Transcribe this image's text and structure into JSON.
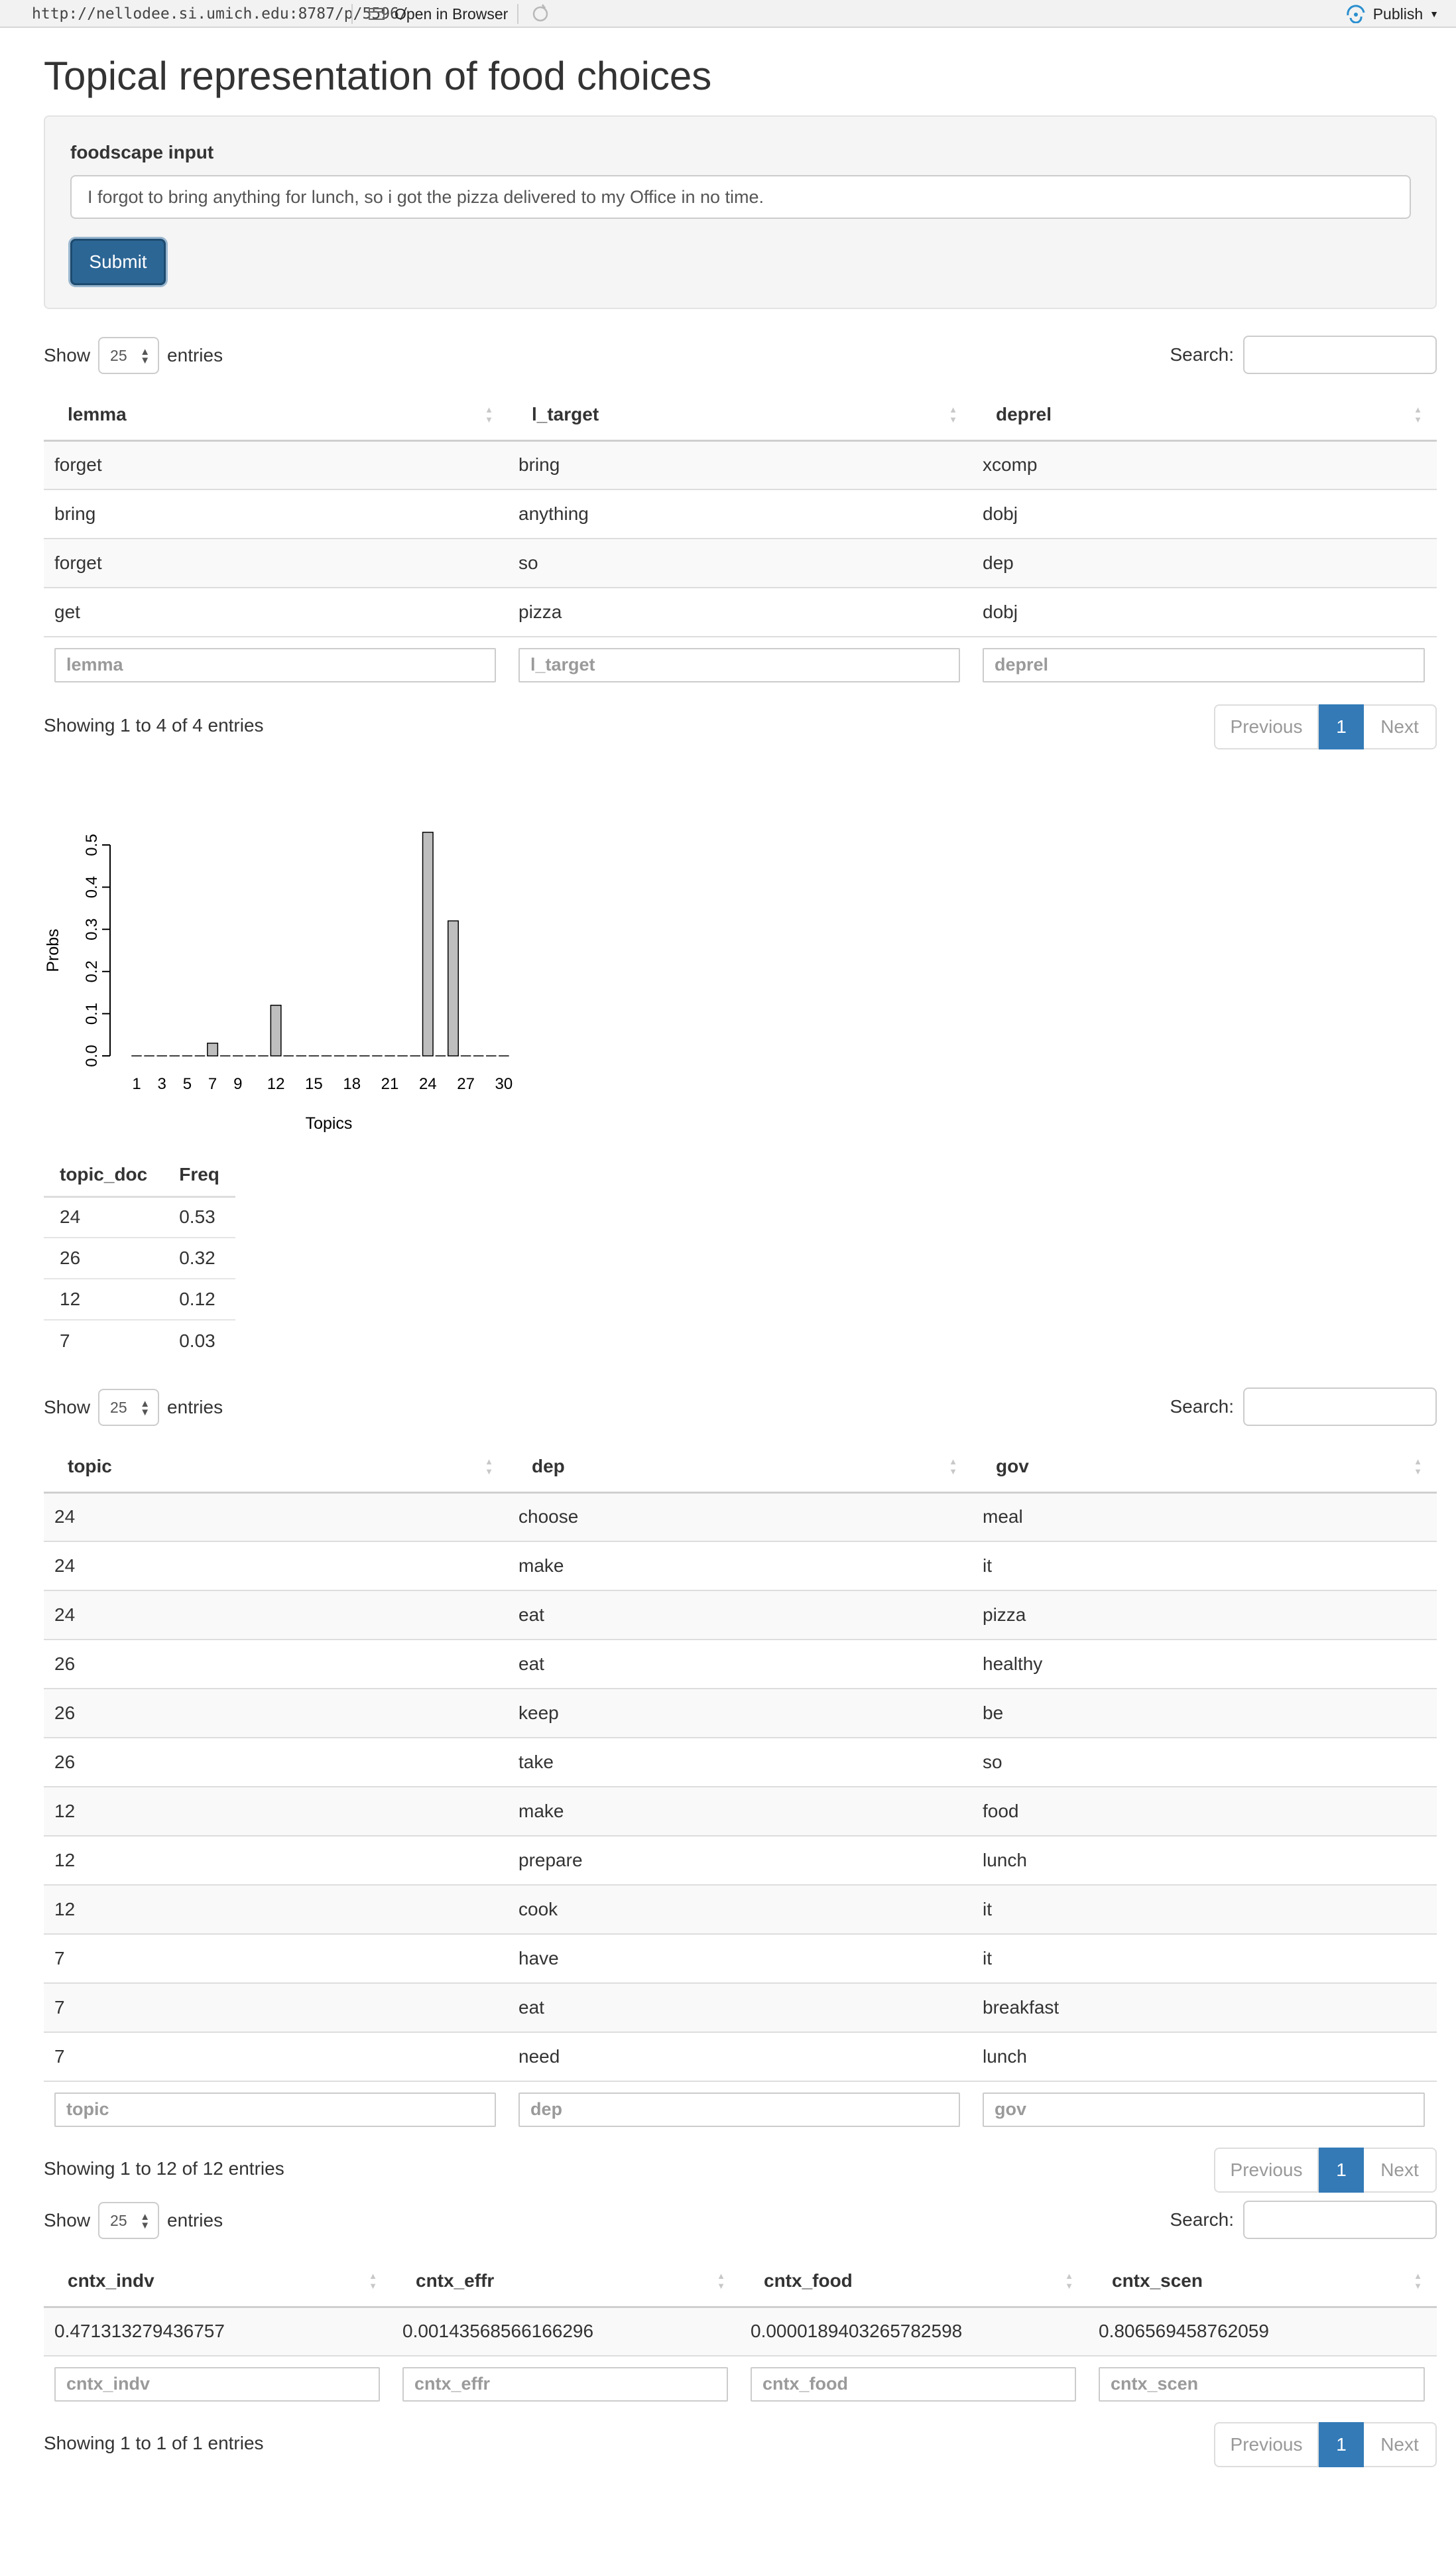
{
  "browser": {
    "url": "http://nellodee.si.umich.edu:8787/p/5596/",
    "open_label": "Open in Browser",
    "publish_label": "Publish"
  },
  "page": {
    "title": "Topical representation of food choices"
  },
  "form": {
    "label": "foodscape input",
    "value": "I forgot to bring anything for lunch, so i got the pizza delivered to my Office in no time.",
    "submit_label": "Submit"
  },
  "controls": {
    "show_label": "Show",
    "entries_label": "entries",
    "page_length": "25",
    "search_label": "Search:",
    "previous_label": "Previous",
    "next_label": "Next",
    "current_page": "1"
  },
  "table1": {
    "columns": [
      "lemma",
      "l_target",
      "deprel"
    ],
    "rows": [
      [
        "forget",
        "bring",
        "xcomp"
      ],
      [
        "bring",
        "anything",
        "dobj"
      ],
      [
        "forget",
        "so",
        "dep"
      ],
      [
        "get",
        "pizza",
        "dobj"
      ]
    ],
    "info": "Showing 1 to 4 of 4 entries"
  },
  "chart_data": {
    "type": "bar",
    "xlabel": "Topics",
    "ylabel": "Probs",
    "ylim": [
      0,
      0.5
    ],
    "yticks": [
      "0.0",
      "0.1",
      "0.2",
      "0.3",
      "0.4",
      "0.5"
    ],
    "xtick_labels": [
      "1",
      "3",
      "5",
      "7",
      "9",
      "12",
      "15",
      "18",
      "21",
      "24",
      "27",
      "30"
    ],
    "categories": [
      1,
      2,
      3,
      4,
      5,
      6,
      7,
      8,
      9,
      10,
      11,
      12,
      13,
      14,
      15,
      16,
      17,
      18,
      19,
      20,
      21,
      22,
      23,
      24,
      25,
      26,
      27,
      28,
      29,
      30
    ],
    "values": [
      0,
      0,
      0,
      0,
      0,
      0,
      0.03,
      0,
      0,
      0,
      0,
      0.12,
      0,
      0,
      0,
      0,
      0,
      0,
      0,
      0,
      0,
      0,
      0,
      0.53,
      0,
      0.32,
      0,
      0,
      0,
      0
    ],
    "bar_color": "#bebebe"
  },
  "freq_table": {
    "columns": [
      "topic_doc",
      "Freq"
    ],
    "rows": [
      [
        "24",
        "0.53"
      ],
      [
        "26",
        "0.32"
      ],
      [
        "12",
        "0.12"
      ],
      [
        "7",
        "0.03"
      ]
    ]
  },
  "table2": {
    "columns": [
      "topic",
      "dep",
      "gov"
    ],
    "rows": [
      [
        "24",
        "choose",
        "meal"
      ],
      [
        "24",
        "make",
        "it"
      ],
      [
        "24",
        "eat",
        "pizza"
      ],
      [
        "26",
        "eat",
        "healthy"
      ],
      [
        "26",
        "keep",
        "be"
      ],
      [
        "26",
        "take",
        "so"
      ],
      [
        "12",
        "make",
        "food"
      ],
      [
        "12",
        "prepare",
        "lunch"
      ],
      [
        "12",
        "cook",
        "it"
      ],
      [
        "7",
        "have",
        "it"
      ],
      [
        "7",
        "eat",
        "breakfast"
      ],
      [
        "7",
        "need",
        "lunch"
      ]
    ],
    "info": "Showing 1 to 12 of 12 entries"
  },
  "table3": {
    "columns": [
      "cntx_indv",
      "cntx_effr",
      "cntx_food",
      "cntx_scen"
    ],
    "rows": [
      [
        "0.471313279436757",
        "0.00143568566166296",
        "0.0000189403265782598",
        "0.806569458762059"
      ]
    ],
    "info": "Showing 1 to 1 of 1 entries"
  }
}
